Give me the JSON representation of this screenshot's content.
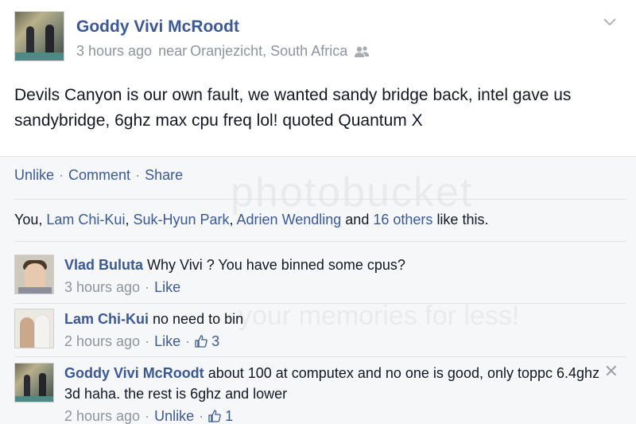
{
  "post": {
    "author": "Goddy Vivi McRoodt",
    "time": "3 hours ago",
    "location_prefix": "near",
    "location": "Oranjezicht, South Africa",
    "privacy_icon": "friends-icon",
    "text": "Devils Canyon is our own fault, we wanted sandy bridge back, intel gave us sandybridge, 6ghz max cpu freq lol! quoted Quantum X"
  },
  "actions": {
    "unlike": "Unlike",
    "comment": "Comment",
    "share": "Share",
    "separator": "·"
  },
  "likes": {
    "you": "You,",
    "people": [
      "Lam Chi-Kui",
      "Suk-Hyun Park",
      "Adrien Wendling"
    ],
    "and": "and",
    "others": "16 others",
    "suffix": "like this."
  },
  "comments": [
    {
      "author": "Vlad Buluta",
      "text": "Why Vivi ? You have binned some cpus?",
      "time": "3 hours ago",
      "action": "Like",
      "like_count": ""
    },
    {
      "author": "Lam Chi-Kui",
      "text": "no need to bin",
      "time": "2 hours ago",
      "action": "Like",
      "like_count": "3"
    },
    {
      "author": "Goddy Vivi McRoodt",
      "text": "about 100 at computex and no one is good, only toppc 6.4ghz 3d haha. the rest is 6ghz and lower",
      "time": "2 hours ago",
      "action": "Unlike",
      "like_count": "1"
    }
  ],
  "watermark": {
    "main": "photobucket",
    "sub": "your memories for less!"
  },
  "colors": {
    "link": "#3b5998",
    "meta": "#90949c",
    "text": "#141823",
    "footer_bg": "#f6f7f9"
  }
}
